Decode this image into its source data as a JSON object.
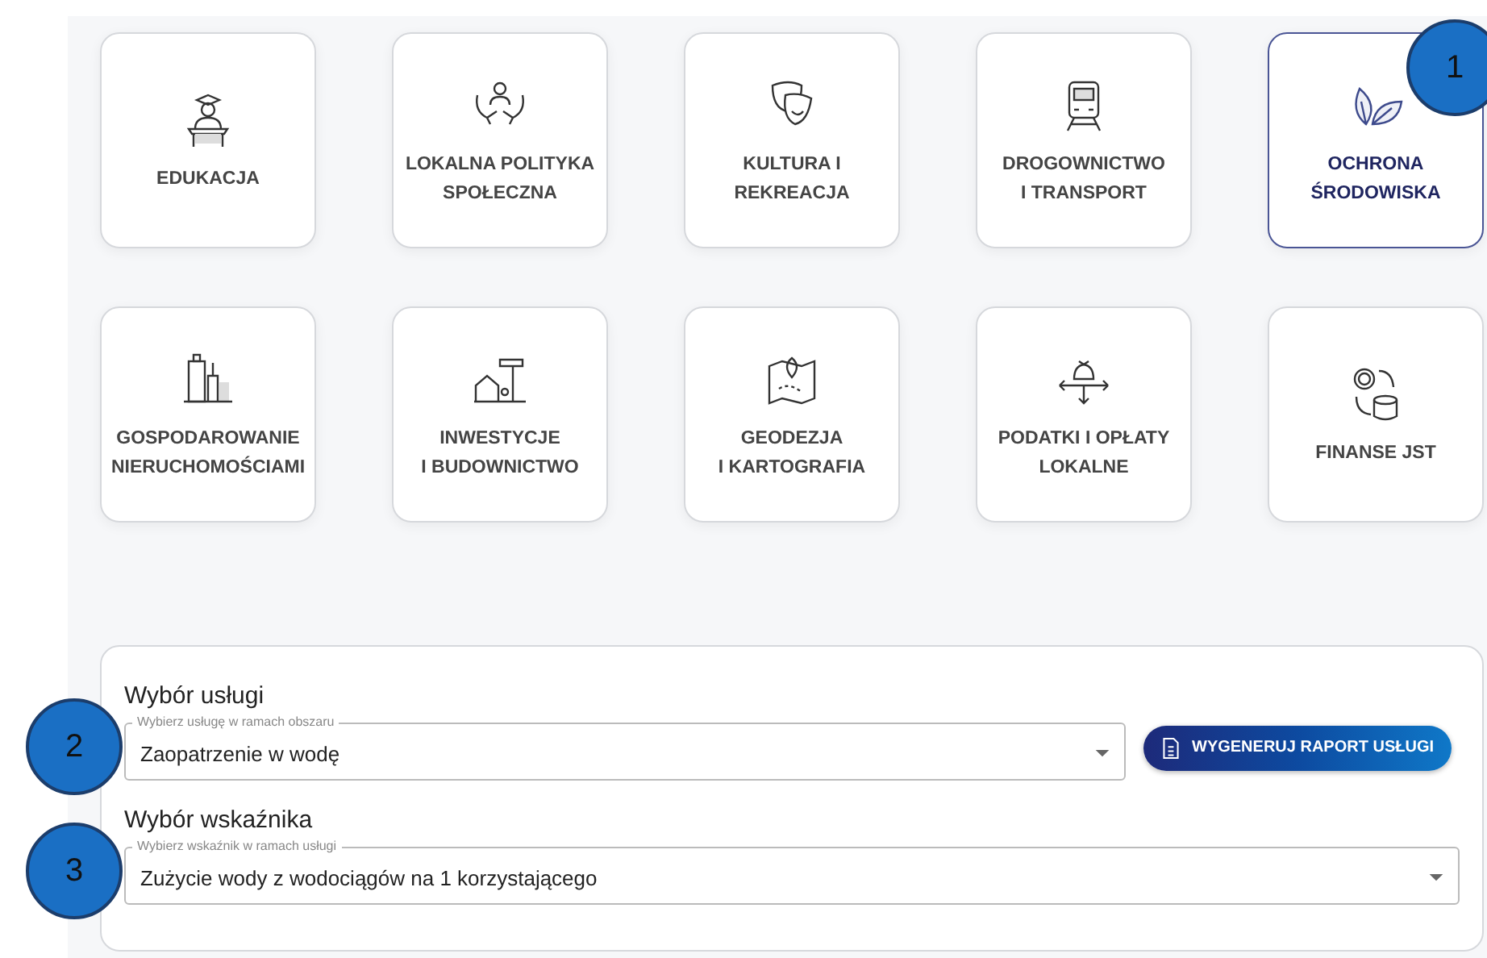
{
  "areas": [
    {
      "label": "EDUKACJA",
      "selected": false
    },
    {
      "label": "LOKALNA POLITYKA\nSPOŁECZNA",
      "selected": false
    },
    {
      "label": "KULTURA I\nREKREACJA",
      "selected": false
    },
    {
      "label": "DROGOWNICTWO\nI TRANSPORT",
      "selected": false
    },
    {
      "label": "OCHRONA\nŚRODOWISKA",
      "selected": true,
      "callout": "1"
    },
    {
      "label": "GOSPODAROWANIE\nNIERUCHOMOŚCIAMI",
      "selected": false
    },
    {
      "label": "INWESTYCJE\nI BUDOWNICTWO",
      "selected": false
    },
    {
      "label": "GEODEZJA\nI KARTOGRAFIA",
      "selected": false
    },
    {
      "label": "PODATKI I OPŁATY\nLOKALNE",
      "selected": false
    },
    {
      "label": "FINANSE JST",
      "selected": false
    }
  ],
  "service": {
    "title": "Wybór usługi",
    "field_label": "Wybierz usługę w ramach obszaru",
    "value": "Zaopatrzenie w wodę",
    "button": "WYGENERUJ RAPORT USŁUGI",
    "callout": "2"
  },
  "indicator": {
    "title": "Wybór wskaźnika",
    "field_label": "Wybierz wskaźnik w ramach usługi",
    "value": "Zużycie wody z wodociągów na 1 korzystającego",
    "callout": "3"
  }
}
